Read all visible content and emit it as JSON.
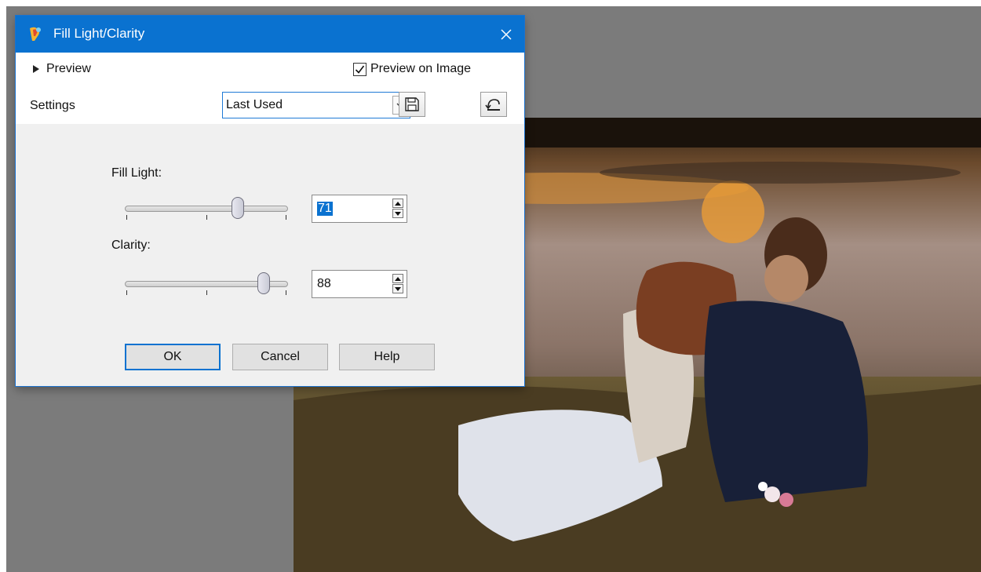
{
  "dialog": {
    "title": "Fill Light/Clarity",
    "preview_toggle_label": "Preview",
    "preview_on_image_label": "Preview on Image",
    "preview_on_image_checked": true,
    "settings_label": "Settings",
    "settings_value": "Last Used",
    "fill_light": {
      "label": "Fill Light:",
      "value": "71",
      "value_fraction": 0.71
    },
    "clarity": {
      "label": "Clarity:",
      "value": "88",
      "value_fraction": 0.88
    },
    "buttons": {
      "ok": "OK",
      "cancel": "Cancel",
      "help": "Help"
    }
  },
  "icons": {
    "app": "paintshop-pro-icon",
    "close": "close-icon",
    "save": "floppy-disk-icon",
    "reset": "reset-arrow-icon"
  },
  "colors": {
    "title_bar": "#0a72d0",
    "workspace": "#7b7b7b",
    "panel": "#f0f0f0"
  }
}
